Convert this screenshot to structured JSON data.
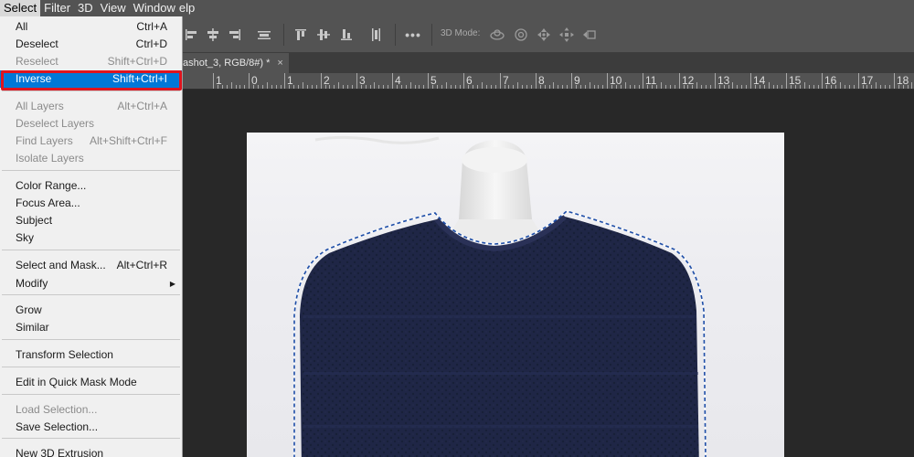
{
  "menubar": {
    "items": [
      "Select",
      "Filter",
      "3D",
      "View",
      "Window",
      "Help"
    ],
    "help_visible": "elp"
  },
  "optionsbar": {
    "more_icon": "more-icon",
    "mode_label": "3D Mode:"
  },
  "document": {
    "tab_title": "ashot_3, RGB/8#) *",
    "close_glyph": "×"
  },
  "ruler": {
    "numbers": [
      "1",
      "0",
      "1",
      "2",
      "3",
      "4",
      "5",
      "6",
      "7",
      "8",
      "9",
      "10",
      "11",
      "12",
      "13",
      "14",
      "15",
      "16",
      "17",
      "18"
    ]
  },
  "select_menu": {
    "items": [
      {
        "label": "All",
        "shortcut": "Ctrl+A",
        "enabled": true
      },
      {
        "label": "Deselect",
        "shortcut": "Ctrl+D",
        "enabled": true
      },
      {
        "label": "Reselect",
        "shortcut": "Shift+Ctrl+D",
        "enabled": false
      },
      {
        "label": "Inverse",
        "shortcut": "Shift+Ctrl+I",
        "enabled": true,
        "highlighted": true
      },
      {
        "label": "All Layers",
        "shortcut": "Alt+Ctrl+A",
        "enabled": false
      },
      {
        "label": "Deselect Layers",
        "shortcut": "",
        "enabled": false
      },
      {
        "label": "Find Layers",
        "shortcut": "Alt+Shift+Ctrl+F",
        "enabled": false
      },
      {
        "label": "Isolate Layers",
        "shortcut": "",
        "enabled": false
      },
      {
        "label": "Color Range...",
        "shortcut": "",
        "enabled": true
      },
      {
        "label": "Focus Area...",
        "shortcut": "",
        "enabled": true
      },
      {
        "label": "Subject",
        "shortcut": "",
        "enabled": true
      },
      {
        "label": "Sky",
        "shortcut": "",
        "enabled": true
      },
      {
        "label": "Select and Mask...",
        "shortcut": "Alt+Ctrl+R",
        "enabled": true
      },
      {
        "label": "Modify",
        "shortcut": "",
        "enabled": true,
        "submenu": true
      },
      {
        "label": "Grow",
        "shortcut": "",
        "enabled": true
      },
      {
        "label": "Similar",
        "shortcut": "",
        "enabled": true
      },
      {
        "label": "Transform Selection",
        "shortcut": "",
        "enabled": true
      },
      {
        "label": "Edit in Quick Mask Mode",
        "shortcut": "",
        "enabled": true
      },
      {
        "label": "Load Selection...",
        "shortcut": "",
        "enabled": false
      },
      {
        "label": "Save Selection...",
        "shortcut": "",
        "enabled": true
      },
      {
        "label": "New 3D Extrusion",
        "shortcut": "",
        "enabled": true
      }
    ]
  },
  "colors": {
    "highlight": "#0078d7",
    "callout_border": "#e0141e",
    "sweater": "#1e2444",
    "canvas_bg": "#282828"
  }
}
